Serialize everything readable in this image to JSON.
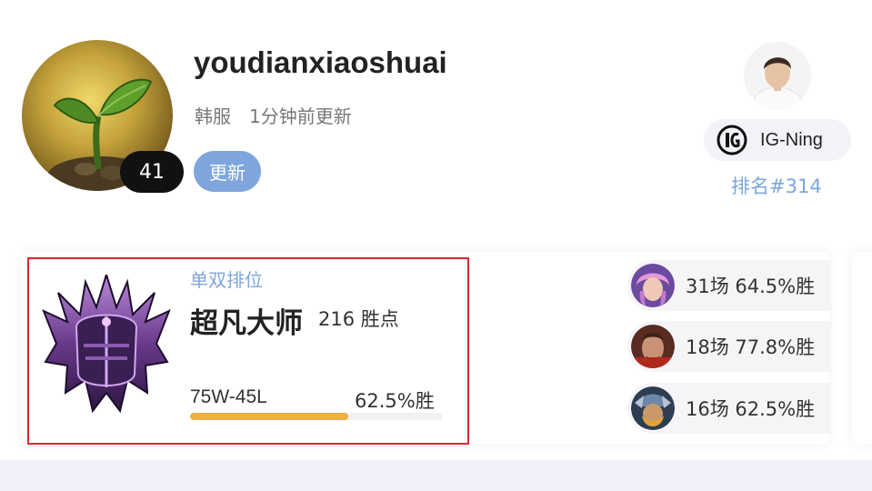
{
  "profile": {
    "username": "youdianxiaoshuai",
    "level": "41",
    "server": "韩服",
    "updated": "1分钟前更新",
    "update_button": "更新",
    "avatar_icon": "sprout-icon"
  },
  "pro_player": {
    "name": "IG-Ning",
    "team_logo": "ig-team-logo-icon",
    "rank": "排名#314"
  },
  "ranked": {
    "queue": "单双排位",
    "tier": "超凡大师",
    "lp": "216 胜点",
    "record": "75W-45L",
    "winrate": "62.5%胜",
    "winrate_fraction": 0.625,
    "emblem": "master-tier-emblem"
  },
  "champions": [
    {
      "icon": "champion-1-icon",
      "stat": "31场 64.5%胜"
    },
    {
      "icon": "champion-2-icon",
      "stat": "18场 77.8%胜"
    },
    {
      "icon": "champion-3-icon",
      "stat": "16场 62.5%胜"
    }
  ],
  "colors": {
    "accent_blue": "#7ea6dd",
    "progress_orange": "#eeae43",
    "highlight_red": "#d9292b"
  }
}
